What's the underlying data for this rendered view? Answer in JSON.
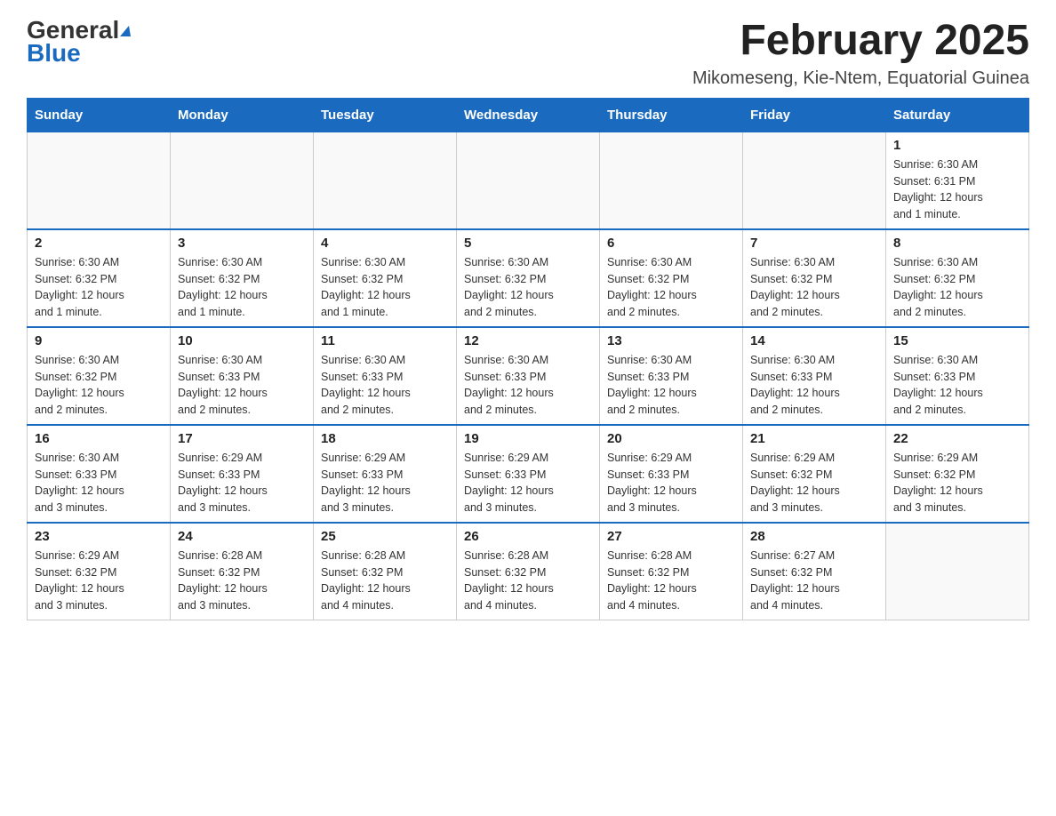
{
  "logo": {
    "general": "General",
    "blue": "Blue"
  },
  "title": "February 2025",
  "subtitle": "Mikomeseng, Kie-Ntem, Equatorial Guinea",
  "weekdays": [
    "Sunday",
    "Monday",
    "Tuesday",
    "Wednesday",
    "Thursday",
    "Friday",
    "Saturday"
  ],
  "weeks": [
    [
      {
        "day": "",
        "info": ""
      },
      {
        "day": "",
        "info": ""
      },
      {
        "day": "",
        "info": ""
      },
      {
        "day": "",
        "info": ""
      },
      {
        "day": "",
        "info": ""
      },
      {
        "day": "",
        "info": ""
      },
      {
        "day": "1",
        "info": "Sunrise: 6:30 AM\nSunset: 6:31 PM\nDaylight: 12 hours\nand 1 minute."
      }
    ],
    [
      {
        "day": "2",
        "info": "Sunrise: 6:30 AM\nSunset: 6:32 PM\nDaylight: 12 hours\nand 1 minute."
      },
      {
        "day": "3",
        "info": "Sunrise: 6:30 AM\nSunset: 6:32 PM\nDaylight: 12 hours\nand 1 minute."
      },
      {
        "day": "4",
        "info": "Sunrise: 6:30 AM\nSunset: 6:32 PM\nDaylight: 12 hours\nand 1 minute."
      },
      {
        "day": "5",
        "info": "Sunrise: 6:30 AM\nSunset: 6:32 PM\nDaylight: 12 hours\nand 2 minutes."
      },
      {
        "day": "6",
        "info": "Sunrise: 6:30 AM\nSunset: 6:32 PM\nDaylight: 12 hours\nand 2 minutes."
      },
      {
        "day": "7",
        "info": "Sunrise: 6:30 AM\nSunset: 6:32 PM\nDaylight: 12 hours\nand 2 minutes."
      },
      {
        "day": "8",
        "info": "Sunrise: 6:30 AM\nSunset: 6:32 PM\nDaylight: 12 hours\nand 2 minutes."
      }
    ],
    [
      {
        "day": "9",
        "info": "Sunrise: 6:30 AM\nSunset: 6:32 PM\nDaylight: 12 hours\nand 2 minutes."
      },
      {
        "day": "10",
        "info": "Sunrise: 6:30 AM\nSunset: 6:33 PM\nDaylight: 12 hours\nand 2 minutes."
      },
      {
        "day": "11",
        "info": "Sunrise: 6:30 AM\nSunset: 6:33 PM\nDaylight: 12 hours\nand 2 minutes."
      },
      {
        "day": "12",
        "info": "Sunrise: 6:30 AM\nSunset: 6:33 PM\nDaylight: 12 hours\nand 2 minutes."
      },
      {
        "day": "13",
        "info": "Sunrise: 6:30 AM\nSunset: 6:33 PM\nDaylight: 12 hours\nand 2 minutes."
      },
      {
        "day": "14",
        "info": "Sunrise: 6:30 AM\nSunset: 6:33 PM\nDaylight: 12 hours\nand 2 minutes."
      },
      {
        "day": "15",
        "info": "Sunrise: 6:30 AM\nSunset: 6:33 PM\nDaylight: 12 hours\nand 2 minutes."
      }
    ],
    [
      {
        "day": "16",
        "info": "Sunrise: 6:30 AM\nSunset: 6:33 PM\nDaylight: 12 hours\nand 3 minutes."
      },
      {
        "day": "17",
        "info": "Sunrise: 6:29 AM\nSunset: 6:33 PM\nDaylight: 12 hours\nand 3 minutes."
      },
      {
        "day": "18",
        "info": "Sunrise: 6:29 AM\nSunset: 6:33 PM\nDaylight: 12 hours\nand 3 minutes."
      },
      {
        "day": "19",
        "info": "Sunrise: 6:29 AM\nSunset: 6:33 PM\nDaylight: 12 hours\nand 3 minutes."
      },
      {
        "day": "20",
        "info": "Sunrise: 6:29 AM\nSunset: 6:33 PM\nDaylight: 12 hours\nand 3 minutes."
      },
      {
        "day": "21",
        "info": "Sunrise: 6:29 AM\nSunset: 6:32 PM\nDaylight: 12 hours\nand 3 minutes."
      },
      {
        "day": "22",
        "info": "Sunrise: 6:29 AM\nSunset: 6:32 PM\nDaylight: 12 hours\nand 3 minutes."
      }
    ],
    [
      {
        "day": "23",
        "info": "Sunrise: 6:29 AM\nSunset: 6:32 PM\nDaylight: 12 hours\nand 3 minutes."
      },
      {
        "day": "24",
        "info": "Sunrise: 6:28 AM\nSunset: 6:32 PM\nDaylight: 12 hours\nand 3 minutes."
      },
      {
        "day": "25",
        "info": "Sunrise: 6:28 AM\nSunset: 6:32 PM\nDaylight: 12 hours\nand 4 minutes."
      },
      {
        "day": "26",
        "info": "Sunrise: 6:28 AM\nSunset: 6:32 PM\nDaylight: 12 hours\nand 4 minutes."
      },
      {
        "day": "27",
        "info": "Sunrise: 6:28 AM\nSunset: 6:32 PM\nDaylight: 12 hours\nand 4 minutes."
      },
      {
        "day": "28",
        "info": "Sunrise: 6:27 AM\nSunset: 6:32 PM\nDaylight: 12 hours\nand 4 minutes."
      },
      {
        "day": "",
        "info": ""
      }
    ]
  ]
}
